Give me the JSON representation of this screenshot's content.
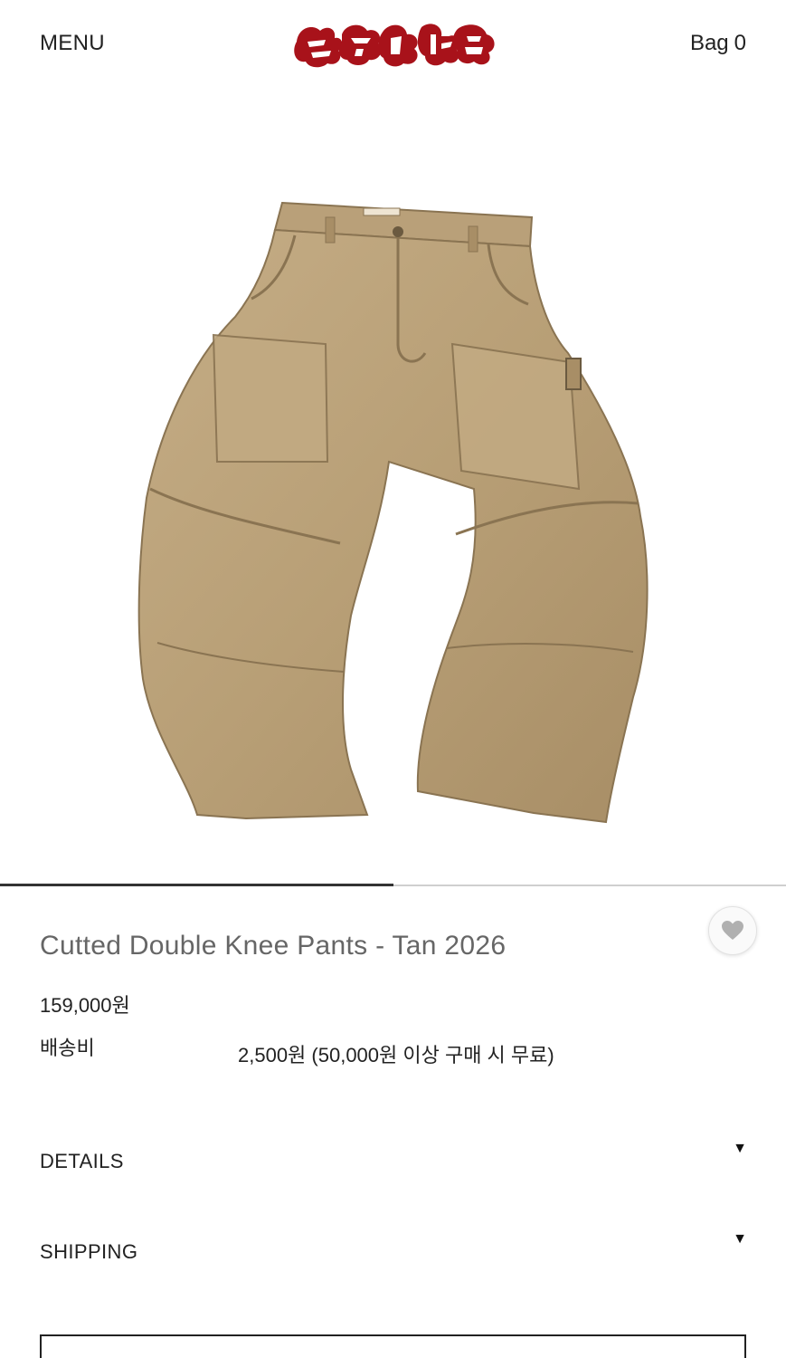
{
  "header": {
    "menu_label": "MENU",
    "bag_label": "Bag",
    "bag_count": "0",
    "logo_color": "#a8121a"
  },
  "product": {
    "image_icon": "tan-double-knee-pants-image",
    "title": "Cutted Double Knee Pants - Tan 2026",
    "price": "159,000원",
    "shipping_label": "배송비",
    "shipping_value": "2,500원 (50,000원 이상 구매 시 무료)",
    "wishlist_icon": "heart-icon"
  },
  "carousel": {
    "progress": 0.5
  },
  "accordions": {
    "details_label": "DETAILS",
    "shipping_label": "SHIPPING",
    "arrow_glyph": "▼"
  },
  "colors": {
    "pants_tan": "#bba27a",
    "pants_stitch": "#8a7452",
    "text": "#222222",
    "title_gray": "#666666"
  }
}
